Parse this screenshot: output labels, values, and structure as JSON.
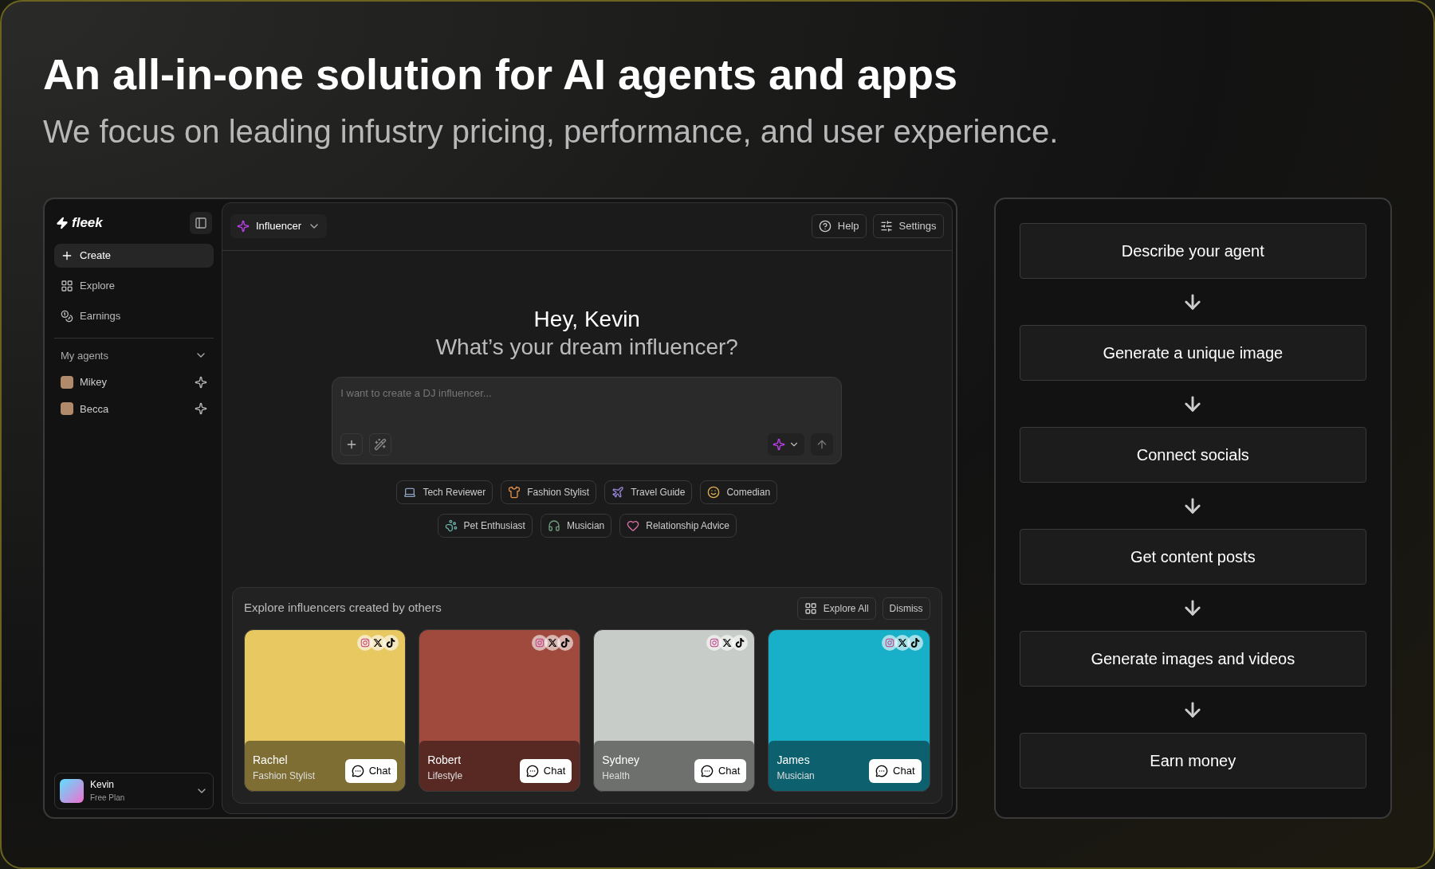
{
  "headline": "An all-in-one solution for AI agents and apps",
  "subheadline": "We focus on leading infustry pricing, performance, and user experience.",
  "sidebar": {
    "logo": "fleek",
    "nav": [
      {
        "label": "Create",
        "selected": true
      },
      {
        "label": "Explore",
        "selected": false
      },
      {
        "label": "Earnings",
        "selected": false
      }
    ],
    "section": "My agents",
    "agents": [
      {
        "name": "Mikey"
      },
      {
        "name": "Becca"
      }
    ],
    "user": {
      "name": "Kevin",
      "plan": "Free Plan"
    }
  },
  "topbar": {
    "mode": "Influencer",
    "buttons": [
      "Help",
      "Settings"
    ]
  },
  "greeting": "Hey, Kevin",
  "question": "What’s your dream influencer?",
  "prompt": {
    "placeholder": "I want to create a DJ influencer..."
  },
  "chips": [
    "Tech Reviewer",
    "Fashion Stylist",
    "Travel Guide",
    "Comedian",
    "Pet Enthusiast",
    "Musician",
    "Relationship Advice"
  ],
  "explore": {
    "title": "Explore influencers created by others",
    "buttons": [
      "Explore All",
      "Dismiss"
    ],
    "cards": [
      {
        "name": "Rachel",
        "category": "Fashion Stylist",
        "color": "#e8c860",
        "chat": "Chat"
      },
      {
        "name": "Robert",
        "category": "Lifestyle",
        "color": "#a04a3e",
        "chat": "Chat"
      },
      {
        "name": "Sydney",
        "category": "Health",
        "color": "#c8ccc8",
        "chat": "Chat"
      },
      {
        "name": "James",
        "category": "Musician",
        "color": "#18b0c8",
        "chat": "Chat"
      }
    ]
  },
  "steps": [
    "Describe your agent",
    "Generate a unique image",
    "Connect socials",
    "Get content posts",
    "Generate images and videos",
    "Earn money"
  ]
}
